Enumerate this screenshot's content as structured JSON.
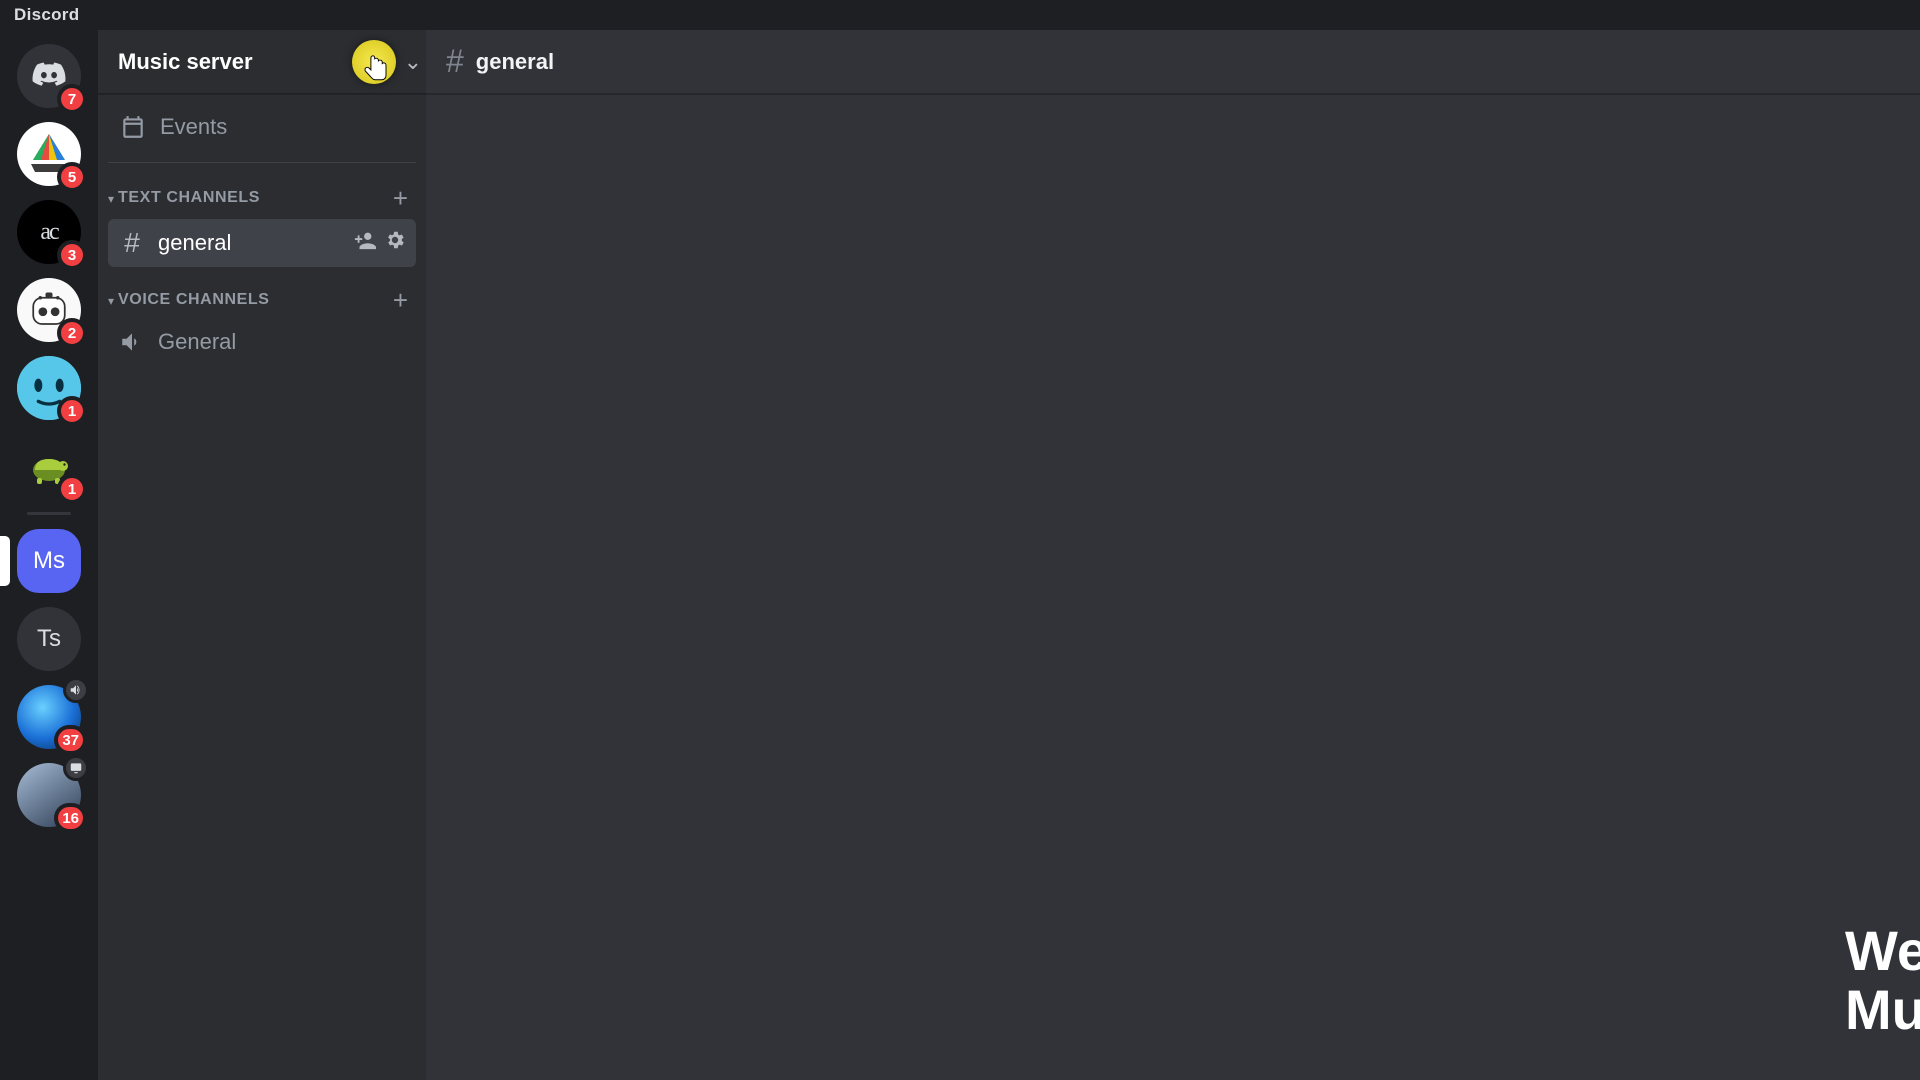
{
  "app": {
    "title": "Discord"
  },
  "servers": {
    "items": [
      {
        "id": "home",
        "abbrev": "",
        "badge": "7",
        "active": false
      },
      {
        "id": "sail",
        "abbrev": "",
        "badge": "5",
        "active": false
      },
      {
        "id": "ac",
        "abbrev": "ac",
        "badge": "3",
        "active": false
      },
      {
        "id": "bot",
        "abbrev": "",
        "badge": "2",
        "active": false
      },
      {
        "id": "blue",
        "abbrev": "",
        "badge": "1",
        "active": false
      },
      {
        "id": "turtle",
        "abbrev": "",
        "badge": "1",
        "active": false
      },
      {
        "id": "ms",
        "abbrev": "Ms",
        "badge": "",
        "active": true
      },
      {
        "id": "ts",
        "abbrev": "Ts",
        "badge": "",
        "active": false
      },
      {
        "id": "glow",
        "abbrev": "",
        "badge": "37",
        "active": false,
        "voice": true
      },
      {
        "id": "top",
        "abbrev": "",
        "badge": "16",
        "active": false,
        "screen": true
      }
    ]
  },
  "sidebar": {
    "server_name": "Music server",
    "events_label": "Events",
    "text_cat": "TEXT CHANNELS",
    "voice_cat": "VOICE CHANNELS",
    "text_channels": [
      {
        "name": "general",
        "active": true
      }
    ],
    "voice_channels": [
      {
        "name": "General"
      }
    ]
  },
  "header": {
    "channel": "general"
  },
  "welcome": {
    "line1": "We",
    "line2": "Mu"
  }
}
